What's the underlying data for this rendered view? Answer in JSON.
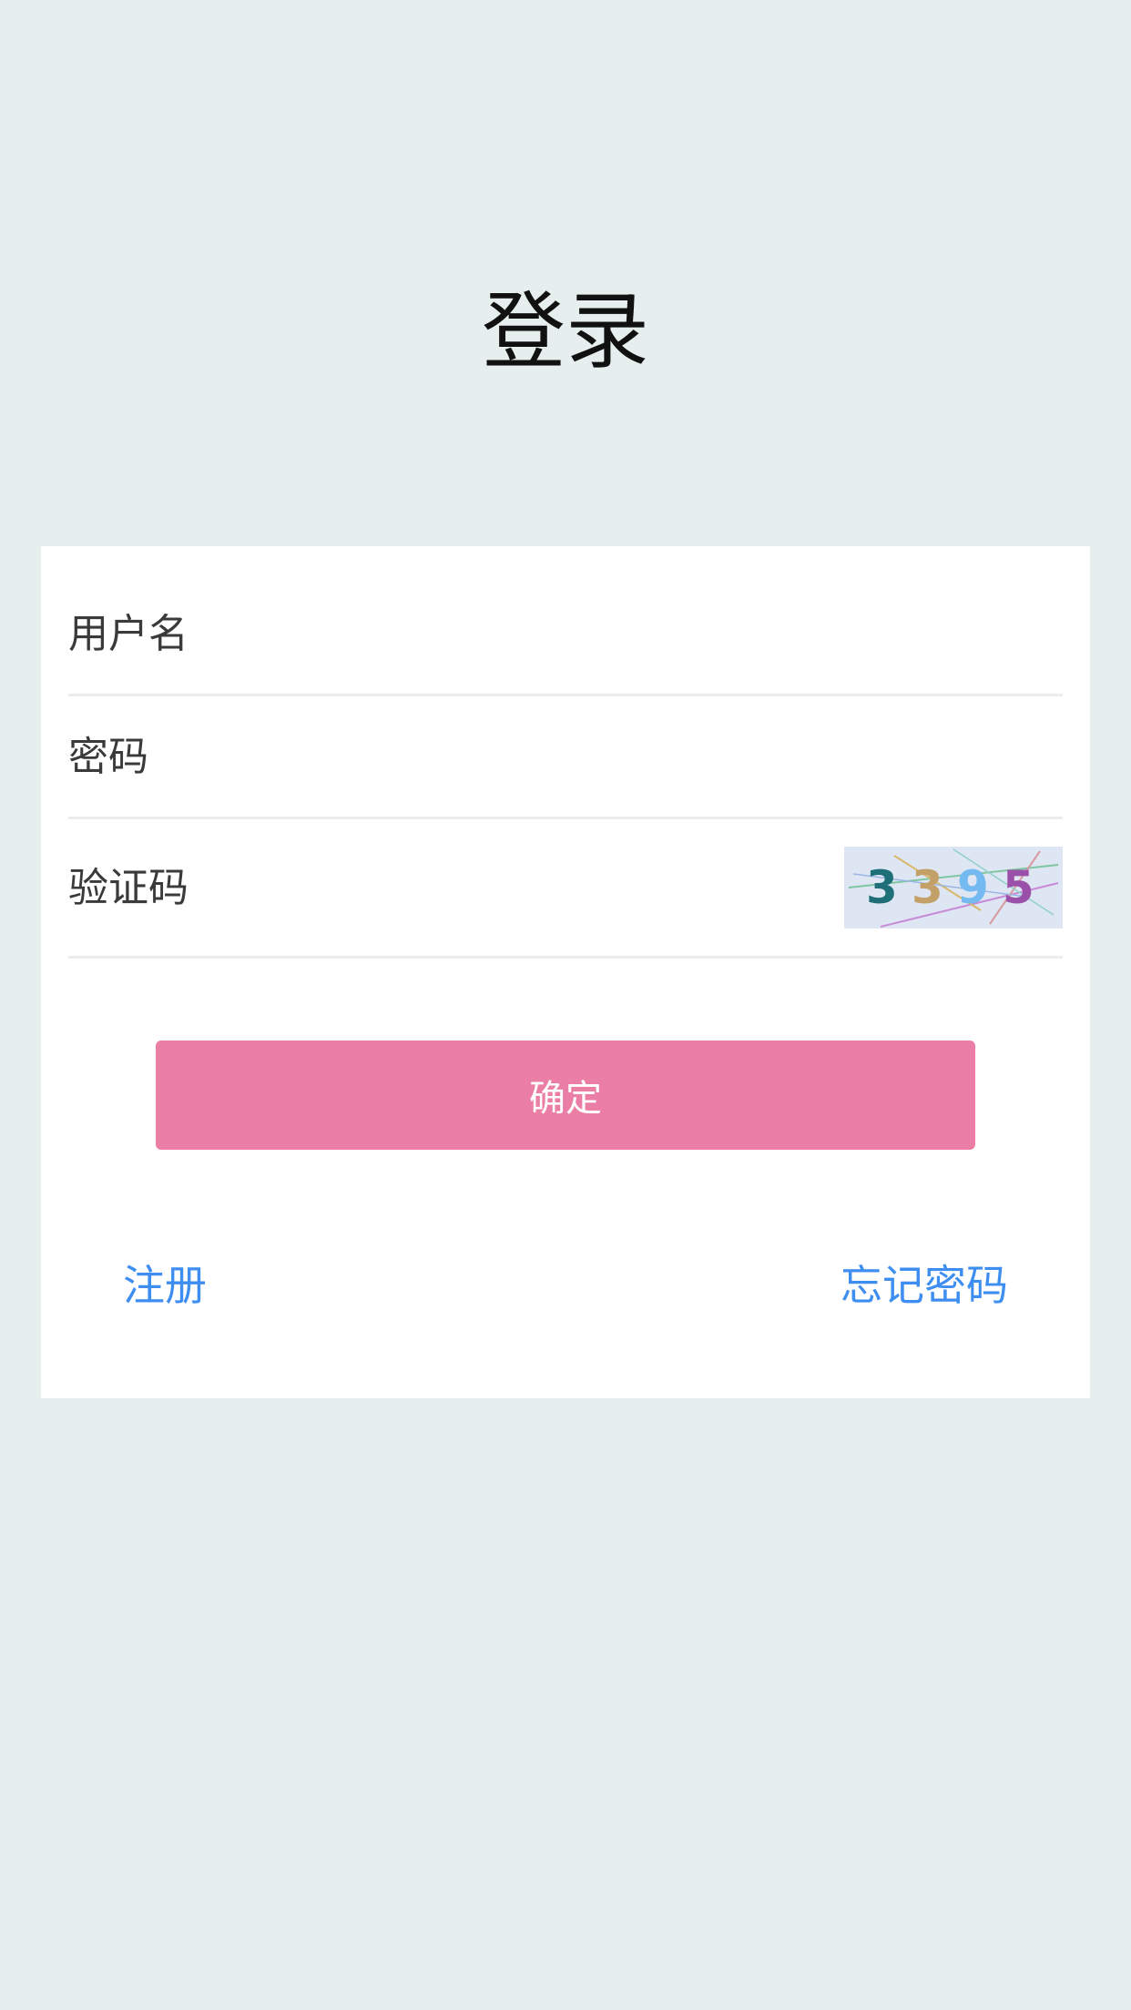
{
  "page": {
    "title": "登录"
  },
  "form": {
    "username_placeholder": "用户名",
    "password_placeholder": "密码",
    "captcha_placeholder": "验证码",
    "captcha_code": "3395",
    "confirm_label": "确定"
  },
  "links": {
    "register_label": "注册",
    "forgot_label": "忘记密码"
  },
  "colors": {
    "background": "#e6eeee",
    "card": "#ffffff",
    "primary_button": "#ea7ea4",
    "link": "#3d8ef0",
    "divider": "#ececec"
  }
}
